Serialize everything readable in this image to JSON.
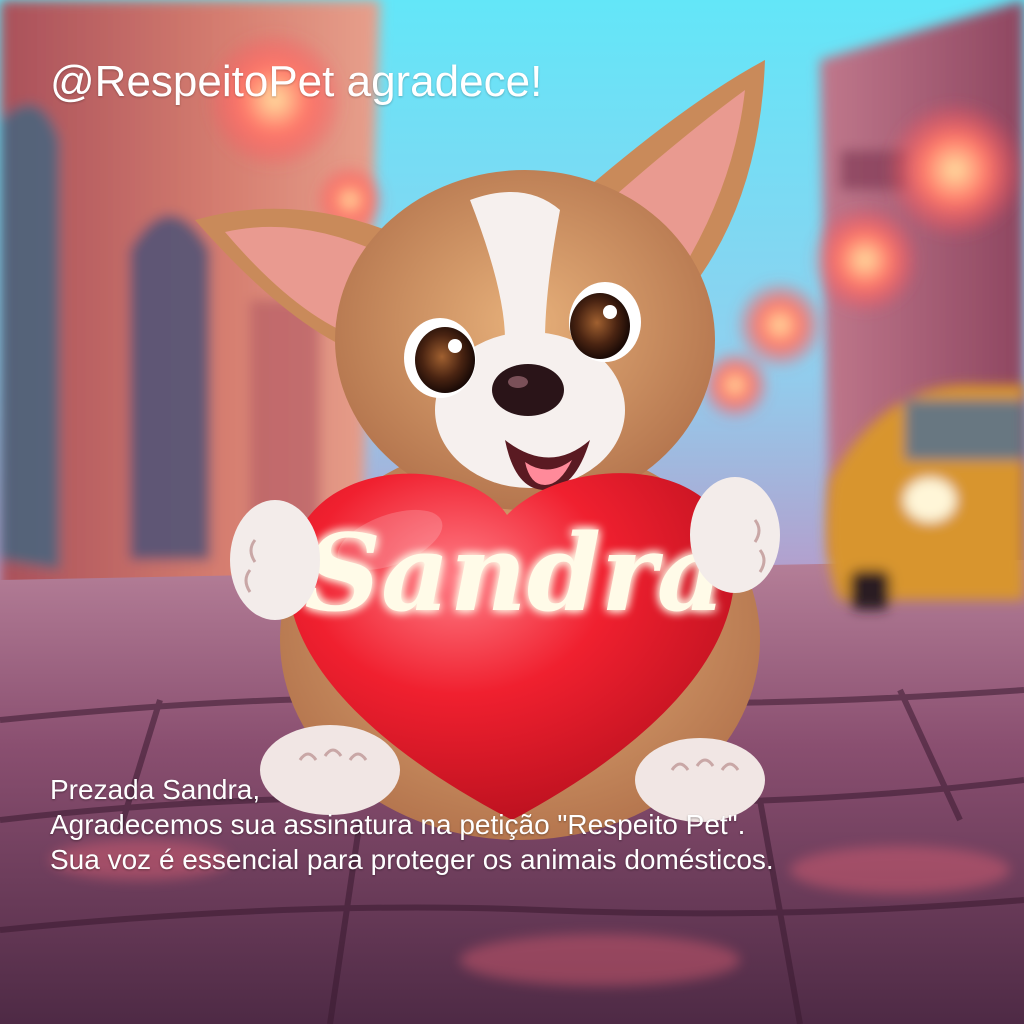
{
  "overlay": {
    "title": "@RespeitoPet agradece!"
  },
  "heart": {
    "name": "Sandra"
  },
  "message": {
    "greeting": "Prezada  Sandra,",
    "line1": "Agradecemos sua assinatura na petição \"Respeito Pet\".",
    "line2": "Sua voz é essencial para proteger os animais domésticos."
  },
  "colors": {
    "sky": "#5fe3f5",
    "wall": "#c96f6a",
    "street": "#7a4c6a",
    "heart": "#ee2233",
    "heart_glow": "#fff4c8",
    "dog_fur": "#c98a5a",
    "dog_white": "#f6f0ee",
    "lantern": "#ff5a5a",
    "car": "#e6a03a"
  },
  "illustration": {
    "subject": "puppy-holding-heart",
    "background": "street-with-lanterns"
  }
}
